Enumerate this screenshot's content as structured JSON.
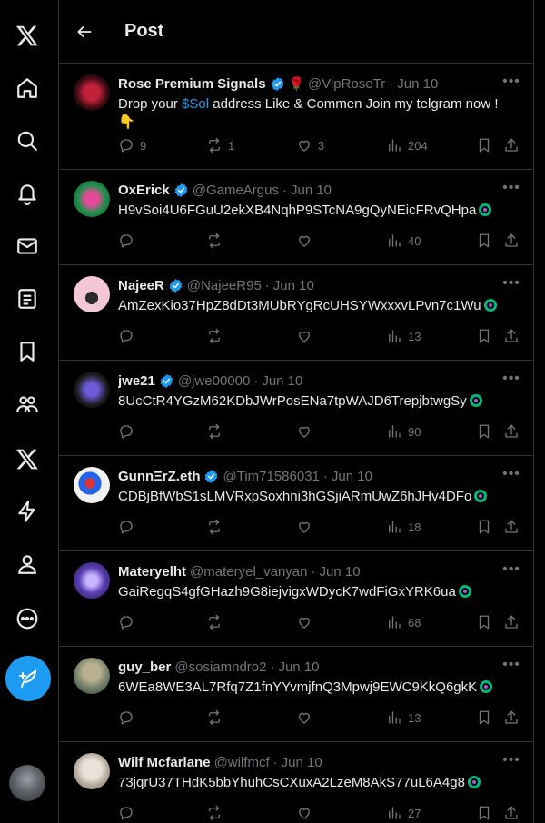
{
  "header": {
    "title": "Post"
  },
  "colors": {
    "accent": "#1d9bf0",
    "verified": "#1d9bf0",
    "muted": "#71767b",
    "background": "#000000"
  },
  "nav": {
    "items": [
      "x-logo-icon",
      "home-icon",
      "explore-icon",
      "notifications-icon",
      "messages-icon",
      "lists-icon",
      "bookmarks-icon",
      "communities-icon",
      "premium-icon",
      "verified-orgs-icon",
      "profile-icon",
      "more-icon"
    ]
  },
  "posts": [
    {
      "name": "Rose Premium Signals",
      "emoji": "🌹",
      "handle": "@VipRoseTr",
      "date": "Jun 10",
      "text_pre": "Drop your ",
      "cashtag": "$Sol",
      "text_post": " address Like & Commen Join my telgram now ! 👇",
      "replies": "9",
      "reposts": "1",
      "likes": "3",
      "views": "204"
    },
    {
      "name": "OxErick",
      "handle": "@GameArgus",
      "date": "Jun 10",
      "text": "H9vSoi4U6FGuU2ekXB4NqhP9STcNA9gQyNEicFRvQHpa",
      "views": "40"
    },
    {
      "name": "NajeeR",
      "handle": "@NajeeR95",
      "date": "Jun 10",
      "text": "AmZexKio37HpZ8dDt3MUbRYgRcUHSYWxxxvLPvn7c1Wu",
      "views": "13"
    },
    {
      "name": "jwe21",
      "handle": "@jwe00000",
      "date": "Jun 10",
      "text": "8UcCtR4YGzM62KDbJWrPosENa7tpWAJD6TrepjbtwgSy",
      "views": "90"
    },
    {
      "name": "GunnΞrZ.eth",
      "handle": "@Tim71586031",
      "date": "Jun 10",
      "text": "CDBjBfWbS1sLMVRxpSoxhni3hGSjiARmUwZ6hJHv4DFo",
      "views": "18"
    },
    {
      "name": "Materyelht",
      "handle": "@materyel_vanyan",
      "date": "Jun 10",
      "text": "GaiRegqS4gfGHazh9G8iejvigxWDycK7wdFiGxYRK6ua",
      "views": "68"
    },
    {
      "name": "guy_ber",
      "handle": "@sosiamndro2",
      "date": "Jun 10",
      "text": "6WEa8WE3AL7Rfq7Z1fnYYvmjfnQ3Mpwj9EWC9KkQ6gkK",
      "views": "13"
    },
    {
      "name": "Wilf Mcfarlane",
      "handle": "@wilfmcf",
      "date": "Jun 10",
      "text": "73jqrU37THdK5bbYhuhCsCXuxA2LzeM8AkS77uL6A4g8",
      "views": "27"
    }
  ]
}
